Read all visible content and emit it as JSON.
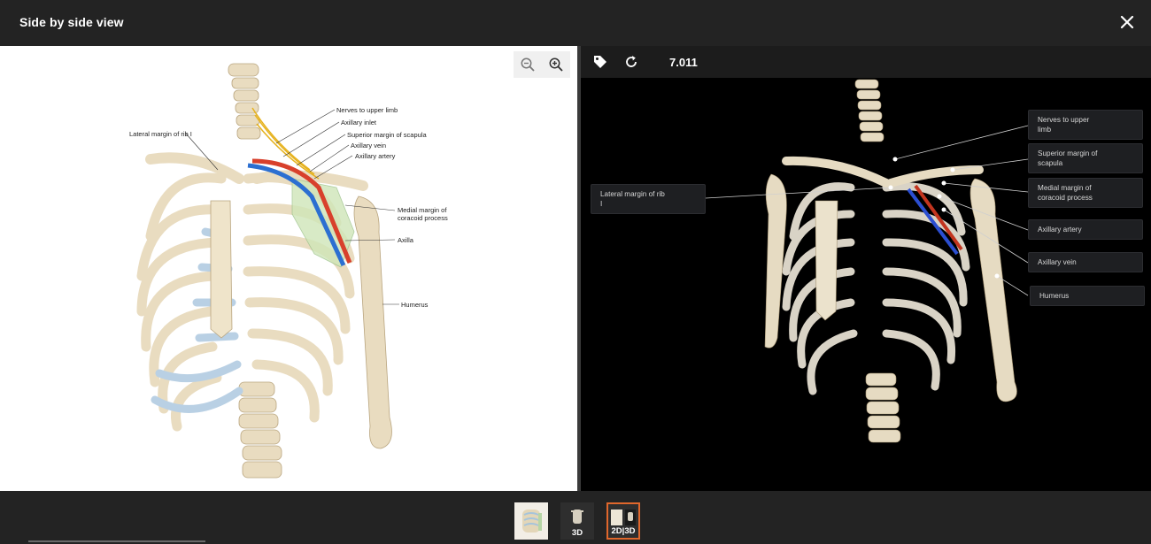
{
  "header": {
    "title": "Side by side view"
  },
  "left_panel": {
    "labels": {
      "nerves": "Nerves to upper limb",
      "axillary_inlet": "Axillary inlet",
      "superior_margin": "Superior margin of scapula",
      "axillary_vein": "Axillary vein",
      "axillary_artery": "Axillary artery",
      "lateral_margin": "Lateral margin of rib I",
      "medial_margin_1": "Medial margin of",
      "medial_margin_2": "coracoid process",
      "axilla": "Axilla",
      "humerus": "Humerus"
    }
  },
  "right_panel": {
    "model_id": "7.011",
    "labels": {
      "lateral_margin_1": "Lateral margin of rib",
      "lateral_margin_2": "I",
      "nerves_1": "Nerves to upper",
      "nerves_2": "limb",
      "superior_1": "Superior margin of",
      "superior_2": "scapula",
      "medial_1": "Medial margin of",
      "medial_2": "coracoid process",
      "axillary_artery": "Axillary artery",
      "axillary_vein": "Axillary vein",
      "humerus": "Humerus"
    }
  },
  "bottom": {
    "thumb_3d_label": "3D",
    "thumb_2d3d_label": "2D|3D"
  },
  "colors": {
    "accent": "#e0672c",
    "bone": "#e9dcc0",
    "cartilage": "#b9d0e4",
    "artery": "#d8402c",
    "vein": "#2c6fd1"
  }
}
